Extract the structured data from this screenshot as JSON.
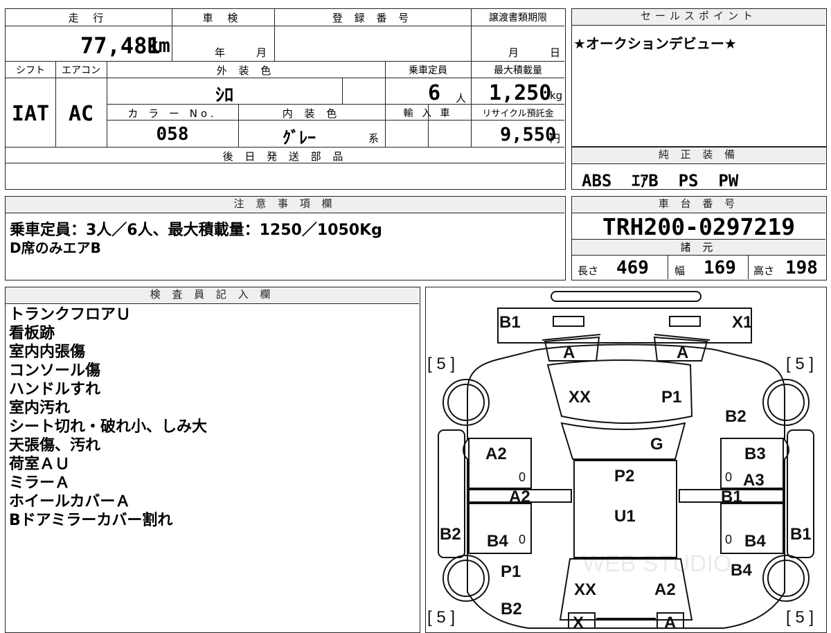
{
  "vehicle": {
    "mileage_label": "走 行",
    "mileage_value": "77,481",
    "mileage_unit": "km",
    "shaken_label": "車 検",
    "shaken_year_unit": "年",
    "shaken_month_unit": "月",
    "reg_number_label": "登 録 番 号",
    "transfer_deadline_label": "譲渡書類期限",
    "transfer_month_unit": "月",
    "transfer_day_unit": "日",
    "shift_label": "シフト",
    "shift_value": "IAT",
    "ac_label": "エアコン",
    "ac_value": "AC",
    "exterior_color_label": "外 装 色",
    "exterior_color_value": "ｼﾛ",
    "capacity_label": "乗車定員",
    "capacity_value": "6",
    "capacity_unit": "人",
    "max_load_label": "最大積載量",
    "max_load_value": "1,250",
    "max_load_unit": "kg",
    "color_no_label": "カ ラ ー No.",
    "color_no_value": "058",
    "interior_color_label": "内 装 色",
    "interior_color_value": "ｸﾞﾚｰ",
    "interior_color_suffix": "系",
    "import_label": "輸 入 車",
    "recycle_label": "リサイクル預託金",
    "recycle_value": "9,550",
    "recycle_unit": "円",
    "later_parts_label": "後 日 発 送 部 品"
  },
  "sales_point": {
    "label": "セールスポイント",
    "text": "★オークションデビュー★"
  },
  "genuine_equipment": {
    "label": "純 正 装 備",
    "value": "ABS  ｴｱB  PS  PW"
  },
  "notes": {
    "label": "注 意 事 項 欄",
    "lines": [
      "乗車定員：3人／6人、最大積載量：1250／1050Kg",
      "D席のみエアB"
    ]
  },
  "chassis": {
    "label": "車 台 番 号",
    "value": "TRH200-0297219"
  },
  "specs": {
    "label": "諸 元",
    "length_label": "長さ",
    "length_value": "469",
    "width_label": "幅",
    "width_value": "169",
    "height_label": "高さ",
    "height_value": "198"
  },
  "inspector": {
    "label": "検 査 員 記 入 欄",
    "lines": [
      "トランクフロアＵ",
      "看板跡",
      "室内内張傷",
      "コンソール傷",
      "ハンドルすれ",
      "室内汚れ",
      "シート切れ・破れ小、しみ大",
      "天張傷、汚れ",
      "荷室ＡＵ",
      "ミラーＡ",
      "ホイールカバーＡ",
      "Bドアミラーカバー割れ"
    ]
  },
  "diagram": {
    "marks": {
      "b1_top_left": "B1",
      "x1_top_right": "X1",
      "a_left_lamp": "A",
      "a_right_lamp": "A",
      "xx_windshield": "XX",
      "p1_windshield": "P1",
      "b2_right_front": "B2",
      "g_hood": "G",
      "a2_left_front_door": "A2",
      "b3_right_front_door": "B3",
      "p2_roof": "P2",
      "a3_right_front_door": "A3",
      "a2_left_mid": "A2",
      "b1_right_mid": "B1",
      "u1_roof": "U1",
      "b2_left_side": "B2",
      "b4_left_rear_door": "B4",
      "b4_right_rear_door": "B4",
      "b1_right_side": "B1",
      "p1_left_rear": "P1",
      "b4_right_rear": "B4",
      "xx_rear_glass": "XX",
      "a2_rear_glass": "A2",
      "b2_left_bottom": "B2",
      "x_rear": "X",
      "a_rear": "A"
    },
    "tire_left_top": "[ 5 ]",
    "tire_right_top": "[ 5 ]",
    "tire_left_bottom": "[ 5 ]",
    "tire_right_bottom": "[ 5 ]",
    "door_zero": "0",
    "watermark": "WEB STUDIO"
  }
}
